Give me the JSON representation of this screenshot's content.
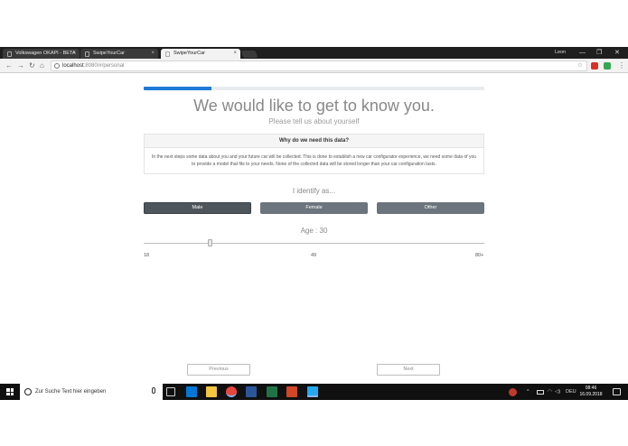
{
  "browser": {
    "tabs": [
      {
        "label": "Volkswagen OKAPI - BETA",
        "active": false
      },
      {
        "label": "SwipeYourCar",
        "active": false
      },
      {
        "label": "SwipeYourCar",
        "active": true
      }
    ],
    "close_glyph": "×",
    "user_name": "Leon",
    "window_controls": {
      "minimize": "—",
      "maximize": "❐",
      "close": "✕"
    },
    "nav": {
      "back": "←",
      "forward": "→",
      "reload": "↻",
      "home": "⌂"
    },
    "url_host": "localhost",
    "url_path": ":8080/#/personal",
    "icons": [
      "page-icon",
      "info-icon",
      "star-icon",
      "extension-icon",
      "menu-icon"
    ]
  },
  "page": {
    "progress": 0.2,
    "title": "We would like to get to know you.",
    "subtitle": "Please tell us about yourself",
    "card": {
      "header": "Why do we need this data?",
      "body": "In the next steps some data about you and your future car will be collected. This is done to establish a new car configurator experience, we need some data of you to provide a model that fits to your needs. None of the collected data will be stored longer than your car configuration lasts."
    },
    "identify_label": "I identify as...",
    "gender_options": [
      "Male",
      "Female",
      "Other"
    ],
    "selected_gender": "Male",
    "age_label": "Age : 30",
    "age": {
      "min": 18,
      "max": 80,
      "value": 30
    },
    "age_ticks": [
      "18",
      "49",
      "80+"
    ],
    "previous_label": "Previous",
    "next_label": "Next"
  },
  "taskbar": {
    "search_placeholder": "Zur Suche Text hier eingeben",
    "language": "DEU",
    "time": "08:46",
    "date": "16.09.2018",
    "tray_glyphs": {
      "chevron": "^",
      "wifi": "◠",
      "volume": "◁)"
    },
    "colors": {
      "edge": "#0078d7",
      "explorer": "#f4c542",
      "chrome": "#e8453c",
      "word": "#2b579a",
      "excel": "#217346",
      "powerpoint": "#d24726",
      "vscode": "#23a9f2"
    }
  },
  "colors": {
    "progress": "#1f7ad8",
    "button": "#6c757d",
    "button_selected": "#4e555b"
  }
}
